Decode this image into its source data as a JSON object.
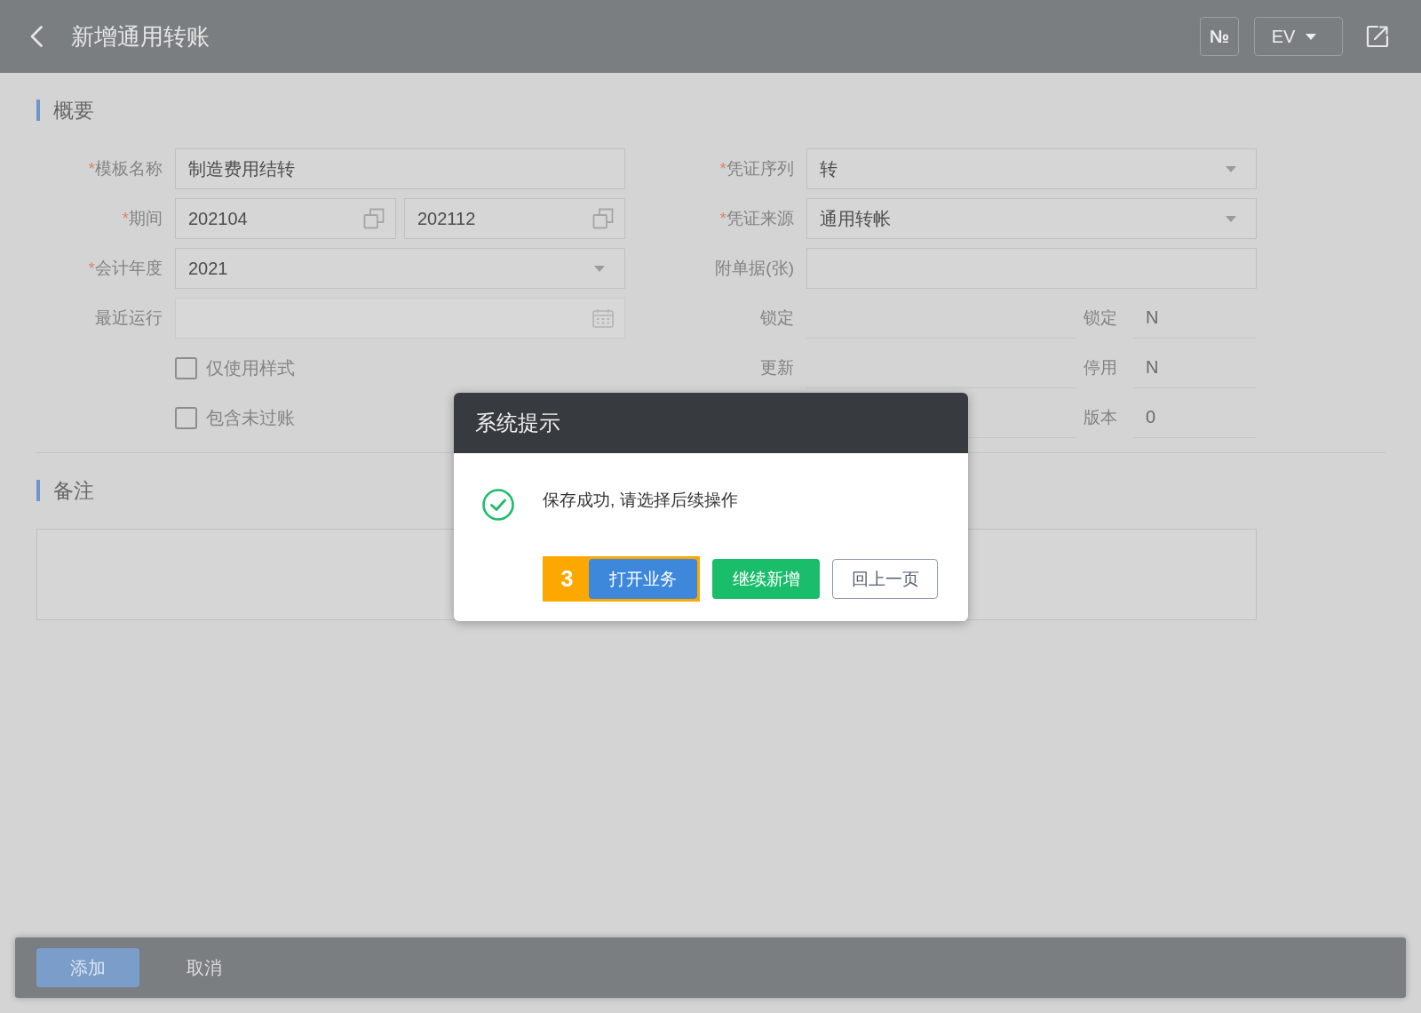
{
  "page_header": {
    "title": "新增通用转账",
    "number_button": "№",
    "language_select": "EV"
  },
  "summary_section": {
    "title": "概要",
    "left_fields": [
      {
        "kind": "text",
        "required_mark": "*",
        "label": "模板名称",
        "value": "制造费用结转",
        "disabled": false
      },
      {
        "kind": "range",
        "required_mark": "*",
        "label": "期间",
        "values": [
          "202104",
          "202112"
        ],
        "disabled": false
      },
      {
        "kind": "select",
        "required_mark": "*",
        "label": "会计年度",
        "value": "2021",
        "disabled": false
      },
      {
        "kind": "date",
        "label": "最近运行",
        "disabled": true
      },
      {
        "kind": "checkbox",
        "label": "仅使用样式",
        "checked": false,
        "disabled": false
      },
      {
        "kind": "checkbox",
        "label": "包含未过账",
        "checked": false,
        "disabled": false
      }
    ],
    "right_fields": [
      {
        "kind": "select",
        "required_mark": "*",
        "label": "凭证序列",
        "value": "转"
      },
      {
        "kind": "select",
        "required_mark": "*",
        "label": "凭证来源",
        "value": "通用转帐"
      },
      {
        "kind": "text",
        "label": "附单据(张)"
      },
      {
        "kind": "readonly",
        "label": "锁定",
        "side_label": "锁定",
        "side_value": "N"
      },
      {
        "kind": "readonly",
        "label": "更新",
        "side_label": "停用",
        "side_value": "N"
      },
      {
        "kind": "readonly",
        "side_label": "版本",
        "side_value": "0"
      }
    ]
  },
  "notes_section": {
    "title": "备注"
  },
  "footer": {
    "buttons": [
      {
        "kind": "primary",
        "label": "添加"
      },
      {
        "kind": "text",
        "label": "取消"
      }
    ]
  },
  "dialog": {
    "title": "系统提示",
    "message": "保存成功, 请选择后续操作",
    "buttons": [
      {
        "kind": "primary",
        "label": "打开业务",
        "step_marker": "3"
      },
      {
        "kind": "success",
        "label": "继续新增"
      },
      {
        "kind": "outline",
        "label": "回上一页"
      }
    ]
  }
}
